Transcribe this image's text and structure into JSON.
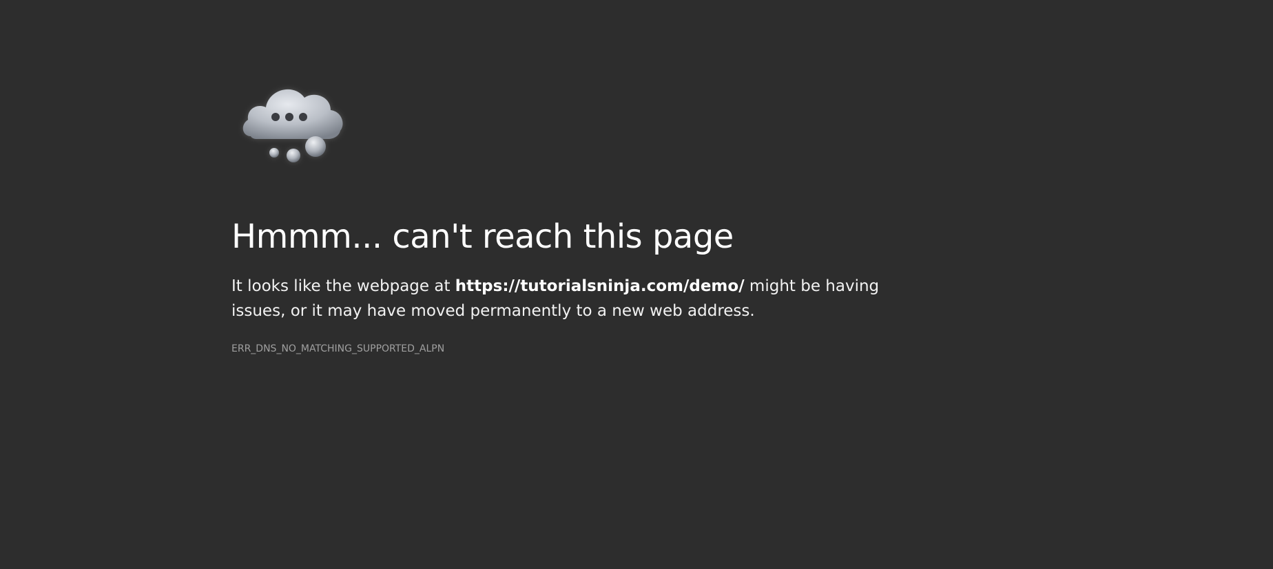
{
  "page": {
    "icon": "cloud-thinking-icon",
    "title": "Hmmm... can't reach this page",
    "message": {
      "prefix": "It looks like the webpage at ",
      "url": "https://tutorialsninja.com/demo/",
      "suffix": " might be having issues, or it may have moved permanently to a new web address."
    },
    "error_code": "ERR_DNS_NO_MATCHING_SUPPORTED_ALPN"
  },
  "colors": {
    "background": "#2d2d2d",
    "text": "#ffffff",
    "muted_text": "#a0a0a0"
  }
}
